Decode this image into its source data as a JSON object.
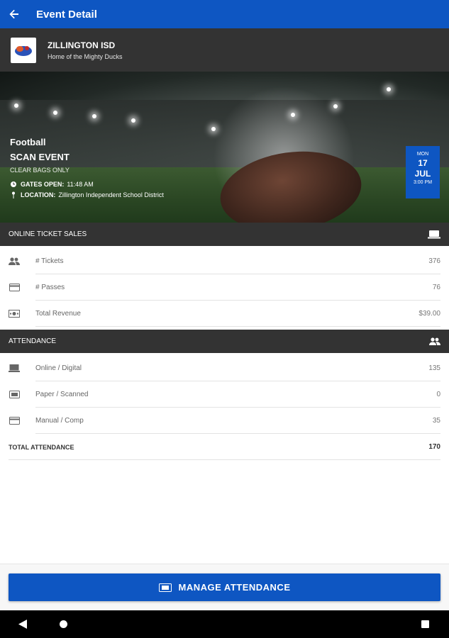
{
  "appbar": {
    "title": "Event Detail"
  },
  "org": {
    "name": "ZILLINGTON ISD",
    "tagline": "Home of the Mighty Ducks"
  },
  "event": {
    "sport": "Football",
    "name": "SCAN EVENT",
    "note": "CLEAR BAGS ONLY",
    "gates_label": "GATES OPEN:",
    "gates_value": "11:48 AM",
    "location_label": "LOCATION:",
    "location_value": "Zillington Independent School District",
    "date": {
      "dow": "MON",
      "day": "17",
      "month": "JUL",
      "time": "3:00 PM"
    }
  },
  "ticket_sales": {
    "header": "ONLINE TICKET SALES",
    "rows": [
      {
        "label": "# Tickets",
        "value": "376",
        "icon": "people-icon"
      },
      {
        "label": "# Passes",
        "value": "76",
        "icon": "card-icon"
      },
      {
        "label": "Total Revenue",
        "value": "$39.00",
        "icon": "money-icon"
      }
    ]
  },
  "attendance": {
    "header": "ATTENDANCE",
    "rows": [
      {
        "label": "Online / Digital",
        "value": "135",
        "icon": "laptop-icon"
      },
      {
        "label": "Paper / Scanned",
        "value": "0",
        "icon": "ticket-icon"
      },
      {
        "label": "Manual / Comp",
        "value": "35",
        "icon": "card-icon"
      }
    ],
    "total_label": "TOTAL ATTENDANCE",
    "total_value": "170"
  },
  "button": {
    "label": "MANAGE ATTENDANCE"
  },
  "colors": {
    "primary": "#0e56c2",
    "dark": "#333333"
  }
}
